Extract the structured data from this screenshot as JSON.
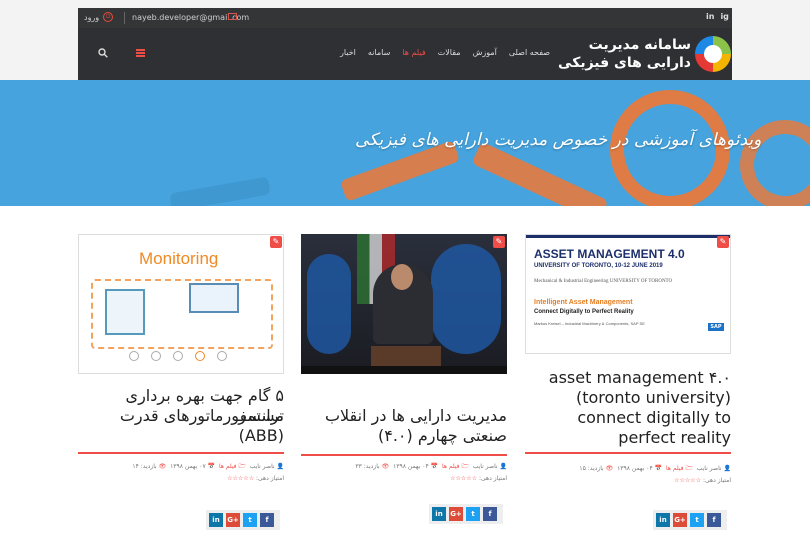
{
  "topbar": {
    "social": [
      "in",
      "ig"
    ],
    "email": "nayeb.developer@gmail.com",
    "login_label": "ورود"
  },
  "navbar": {
    "logo_line1": "سامانه مدیریت",
    "logo_line2": "دارایی های فیزیکی",
    "menu": [
      "صفحه اصلی",
      "آموزش",
      "مقالات",
      "فیلم ها",
      "سامانه",
      "اخبار"
    ],
    "active_menu": "فیلم ها"
  },
  "hero": {
    "caption": "ویدئوهای آموزشی در خصوص مدیریت دارایی های فیزیکی"
  },
  "cards": [
    {
      "thumb_title": "Monitoring",
      "title_l1": "۵ گام جهت بهره برداری مستمر",
      "title_l2": "ترانسفورماتورهای قدرت",
      "title_l3": "(ABB)",
      "author": "ناصر نایب",
      "category": "فیلم ها",
      "date": "۰۷ بهمن ۱۳۹۸",
      "views": "بازدید: ۱۴",
      "rating_label": "امتیاز دهی:",
      "stars": "☆☆☆☆☆"
    },
    {
      "title_l1": "مدیریت دارایی ها در انقلاب",
      "title_l2": "صنعتی چهارم (۴.۰)",
      "author": "ناصر نایب",
      "category": "فیلم ها",
      "date": "۰۴ بهمن ۱۳۹۸",
      "views": "بازدید: ۳۳",
      "rating_label": "امتیاز دهی:",
      "stars": "☆☆☆☆☆"
    },
    {
      "thumb_h1": "ASSET MANAGEMENT 4.0",
      "thumb_h2": "UNIVERSITY OF TORONTO, 10-12 JUNE 2019",
      "thumb_uni": "Mechanical & Industrial Engineering UNIVERSITY OF TORONTO",
      "thumb_s1": "Intelligent Asset Management",
      "thumb_s2": "Connect Digitally to Perfect Reality",
      "thumb_s3": "Markus Kreisel – Industrial Machinery & Components, SAP SE",
      "thumb_brand": "SAP",
      "title_l1": "asset management ۴.۰",
      "title_l2": "(toronto university)",
      "title_l3": "connect digitally to",
      "title_l4": "perfect reality",
      "author": "ناصر نایب",
      "category": "فیلم ها",
      "date": "۰۴ بهمن ۱۳۹۸",
      "views": "بازدید: ۱۵",
      "rating_label": "امتیاز دهی:",
      "stars": "☆☆☆☆☆"
    }
  ],
  "share": [
    "in",
    "G+",
    "t",
    "f"
  ],
  "colors": {
    "accent": "#ef4d47",
    "nav": "#2e3033",
    "hero": "#46a3dd",
    "orange": "#f07834"
  }
}
